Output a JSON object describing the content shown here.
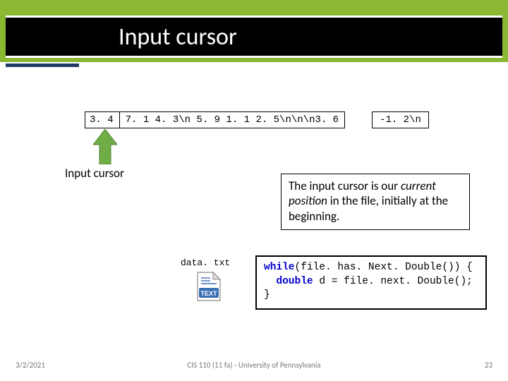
{
  "title": "Input cursor",
  "stream": {
    "first": "3. 4",
    "rest": " 7. 1 4. 3\\n 5. 9 1. 1 2. 5\\n\\n\\n3. 6",
    "tail": "-1. 2\\n"
  },
  "cursor_label": "Input cursor",
  "explain": {
    "part1": "The input cursor is our ",
    "ital": "current position",
    "part2": " in the file, initially at the beginning."
  },
  "file_label": "data. txt",
  "code": {
    "kw_while": "while",
    "l1_rest": "(file. has. Next. Double()) {",
    "l2_indent": "  ",
    "kw_double": "double",
    "l2_rest": " d = file. next. Double();",
    "l3": "}"
  },
  "footer": {
    "date": "3/2/2021",
    "center": "CIS 110 (11 fa) - University of Pennsylvania",
    "page": "23"
  }
}
